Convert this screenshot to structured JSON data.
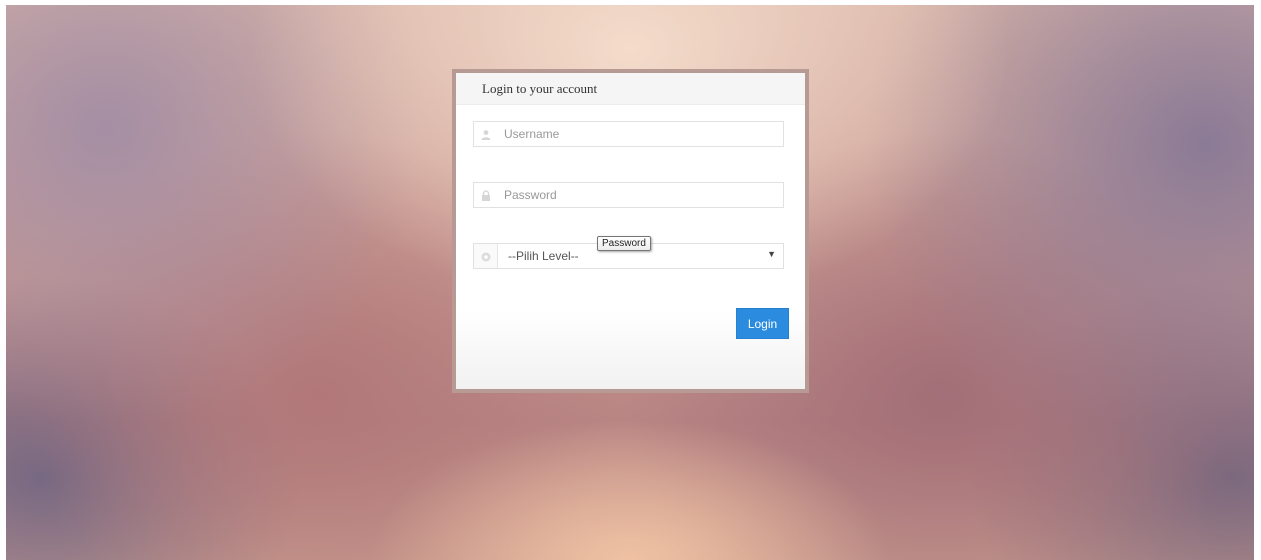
{
  "login": {
    "title": "Login to your account",
    "username_placeholder": "Username",
    "password_placeholder": "Password",
    "level_select": "--Pilih Level--",
    "tooltip": "Password",
    "button_label": "Login"
  },
  "icons": {
    "username": "user-icon",
    "password": "lock-icon",
    "level": "circle-icon",
    "dropdown": "caret-down-icon"
  },
  "colors": {
    "button": "#2b8bdf",
    "card_border": "#b79a93"
  }
}
